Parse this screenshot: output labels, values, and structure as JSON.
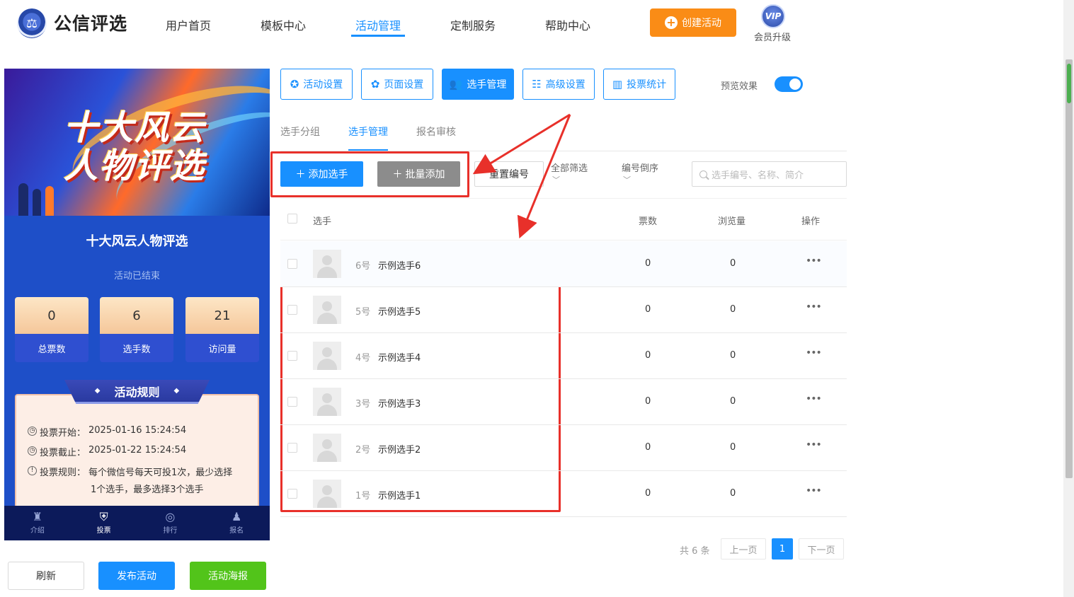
{
  "header": {
    "brand": "公信评选",
    "nav": [
      "用户首页",
      "模板中心",
      "活动管理",
      "定制服务",
      "帮助中心"
    ],
    "active_nav": "活动管理",
    "create_button": "创建活动",
    "vip_badge": "VIP",
    "vip_label": "会员升级"
  },
  "preview": {
    "banner_line1": "十大风云",
    "banner_line2": "人物评选",
    "title": "十大风云人物评选",
    "status": "活动已结束",
    "stats": [
      {
        "value": "0",
        "label": "总票数"
      },
      {
        "value": "6",
        "label": "选手数"
      },
      {
        "value": "21",
        "label": "访问量"
      }
    ],
    "rules_title": "活动规则",
    "rules": [
      {
        "label": "投票开始：",
        "value": "2025-01-16 15:24:54"
      },
      {
        "label": "投票截止：",
        "value": "2025-01-22 15:24:54"
      },
      {
        "label": "投票规则：",
        "value": "每个微信号每天可投1次，最少选择",
        "value2": "1个选手，最多选择3个选手"
      }
    ],
    "tabs": [
      "介绍",
      "投票",
      "排行",
      "报名"
    ],
    "active_tab": "投票"
  },
  "bottom_buttons": {
    "refresh": "刷新",
    "publish": "发布活动",
    "poster": "活动海报"
  },
  "toolbar": {
    "buttons": [
      "活动设置",
      "页面设置",
      "选手管理",
      "高级设置",
      "投票统计"
    ],
    "active": "选手管理",
    "preview_label": "预览效果",
    "preview_on": true
  },
  "subtabs": [
    "选手分组",
    "选手管理",
    "报名审核"
  ],
  "active_subtab": "选手管理",
  "actions": {
    "add": "添加选手",
    "bulk_add": "批量添加",
    "reset": "重置编号",
    "filter_all": "全部筛选",
    "sort": "编号倒序",
    "search_placeholder": "选手编号、名称、简介"
  },
  "table": {
    "headers": {
      "player": "选手",
      "votes": "票数",
      "views": "浏览量",
      "ops": "操作"
    },
    "rows": [
      {
        "num": "6号",
        "name": "示例选手6",
        "votes": "0",
        "views": "0"
      },
      {
        "num": "5号",
        "name": "示例选手5",
        "votes": "0",
        "views": "0"
      },
      {
        "num": "4号",
        "name": "示例选手4",
        "votes": "0",
        "views": "0"
      },
      {
        "num": "3号",
        "name": "示例选手3",
        "votes": "0",
        "views": "0"
      },
      {
        "num": "2号",
        "name": "示例选手2",
        "votes": "0",
        "views": "0"
      },
      {
        "num": "1号",
        "name": "示例选手1",
        "votes": "0",
        "views": "0"
      }
    ]
  },
  "pagination": {
    "total": "共 6 条",
    "prev": "上一页",
    "current": "1",
    "next": "下一页"
  },
  "colors": {
    "primary": "#1890ff",
    "orange": "#fa8c16",
    "green": "#52c41a",
    "annotation_red": "#e8302a"
  }
}
